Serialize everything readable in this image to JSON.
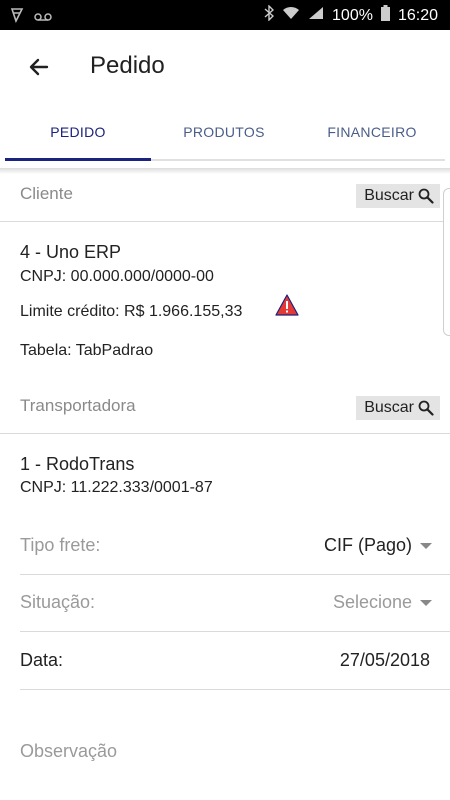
{
  "status_bar": {
    "battery": "100%",
    "time": "16:20",
    "icons": [
      "notification-icon",
      "voicemail-icon",
      "bluetooth-icon",
      "wifi-icon",
      "signal-icon",
      "battery-icon"
    ]
  },
  "app_bar": {
    "title": "Pedido",
    "back_icon": "arrow-back-icon"
  },
  "tabs": [
    {
      "label": "PEDIDO",
      "active": true
    },
    {
      "label": "PRODUTOS",
      "active": false
    },
    {
      "label": "FINANCEIRO",
      "active": false
    }
  ],
  "cliente": {
    "section_label": "Cliente",
    "search_label": "Buscar",
    "name": "4 - Uno ERP",
    "cnpj": "CNPJ: 00.000.000/0000-00",
    "credit_limit": "Limite crédito: R$ 1.966.155,33",
    "warning_icon": "warning-icon",
    "table": "Tabela: TabPadrao"
  },
  "transportadora": {
    "section_label": "Transportadora",
    "search_label": "Buscar",
    "name": "1 - RodoTrans",
    "cnpj": "CNPJ: 11.222.333/0001-87"
  },
  "fields": {
    "tipo_frete": {
      "label": "Tipo frete:",
      "value": "CIF (Pago)"
    },
    "situacao": {
      "label": "Situação:",
      "value": "Selecione"
    },
    "data": {
      "label": "Data:",
      "value": "27/05/2018"
    }
  },
  "observacao": {
    "placeholder": "Observação"
  },
  "colors": {
    "accent": "#1a237e",
    "tab_inactive": "#4a5d8a",
    "warning": "#e53935"
  }
}
